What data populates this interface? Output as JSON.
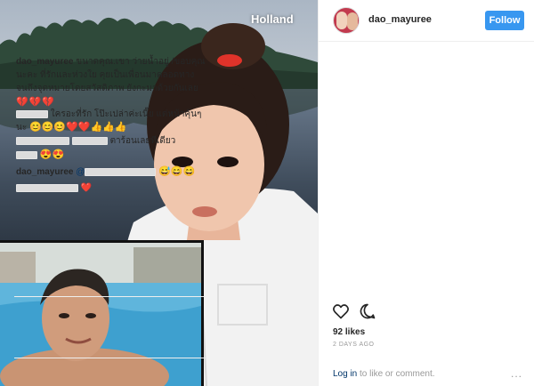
{
  "photo": {
    "location_overlay": "Holland"
  },
  "post": {
    "username": "dao_mayuree",
    "follow_label": "Follow",
    "caption": "ขนาดคุณ.เขา ว่ายน้ำอยู่ /ขอบคุณนะคะ ที่รักและห่วงใย คุยเป็นเพื่อนมาคลอดทางจนถึงจุดหมายโดยสวัสดิภาพ ยังกะมาด้วยกันเลย",
    "caption_hearts": "💔💔💔",
    "comments": [
      {
        "text": "ใครอะที่รัก โป๊ะเปล่าค่ะเนี๊ย แต่หน้าคุ้นๆนะ",
        "emoji": "😊😊😊❤️❤️👍👍👍"
      },
      {
        "text": "ตาร้อนเลยทีเดียว",
        "emoji": "😍😍"
      },
      {
        "text": "dao_mayuree",
        "mention": "@",
        "emoji": "😅😄😄"
      },
      {
        "text": "",
        "emoji": "❤️"
      }
    ],
    "likes": "92 likes",
    "time": "2 DAYS AGO",
    "login_link": "Log in",
    "login_rest": " to like or comment.",
    "more": "..."
  },
  "icons": {
    "like": "heart-outline-icon",
    "comment": "speech-bubble-icon"
  },
  "colors": {
    "follow_bg": "#3897f0",
    "link": "#003569",
    "heart": "#ed2e4f",
    "muted": "#999999"
  }
}
